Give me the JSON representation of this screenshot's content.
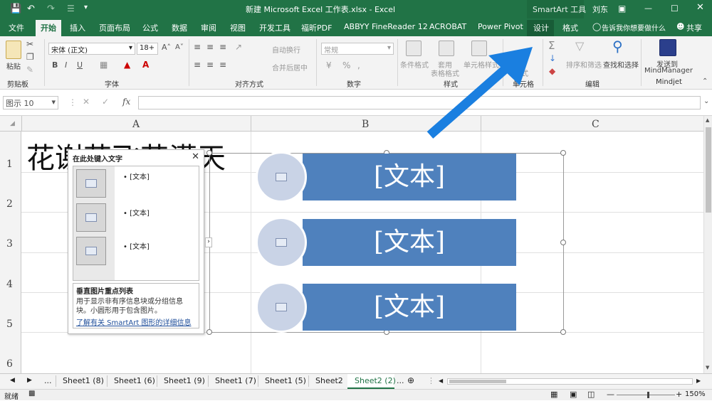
{
  "titlebar": {
    "document_title": "新建 Microsoft Excel 工作表.xlsx - Excel",
    "context_tools": "SmartArt 工具",
    "user": "刘东"
  },
  "tabs": [
    "文件",
    "开始",
    "插入",
    "页面布局",
    "公式",
    "数据",
    "审阅",
    "视图",
    "开发工具",
    "福昕PDF",
    "ABBYY FineReader 12",
    "ACROBAT",
    "Power Pivot",
    "设计",
    "格式"
  ],
  "tell_me": "告诉我你想要做什么",
  "share": "共享",
  "ribbon": {
    "clipboard": {
      "paste": "粘贴",
      "label": "剪贴板"
    },
    "font": {
      "name": "宋体 (正文)",
      "size": "18+",
      "label": "字体"
    },
    "alignment": {
      "wrap": "自动换行",
      "merge": "合并后居中",
      "label": "对齐方式"
    },
    "number": {
      "format": "常规",
      "label": "数字"
    },
    "styles": {
      "conditional": "条件格式",
      "table": "套用\n表格格式",
      "cell": "单元格样式",
      "label": "样式"
    },
    "cells": {
      "format": "格式",
      "label": "单元格"
    },
    "editing": {
      "sort": "排序和筛选",
      "find": "查找和选择",
      "label": "编辑"
    },
    "mindjet": {
      "send": "发送到\nMindManager",
      "label": "Mindjet"
    }
  },
  "formula_bar": {
    "name_box": "图示 10",
    "fx": "fx",
    "content": ""
  },
  "grid": {
    "columns": [
      "A",
      "B",
      "C"
    ],
    "rows": [
      "1",
      "2",
      "3",
      "4",
      "5",
      "6"
    ],
    "a1_value": "花谢花飞花满天"
  },
  "smartart": {
    "items": [
      "[文本]",
      "[文本]",
      "[文本]"
    ]
  },
  "text_pane": {
    "title": "在此处键入文字",
    "bullets": [
      "[文本]",
      "[文本]",
      "[文本]"
    ],
    "layout_name": "垂直图片重点列表",
    "description": "用于显示非有序信息块或分组信息块。小圆形用于包含图片。",
    "more_link": "了解有关 SmartArt 图形的详细信息"
  },
  "sheets": [
    "Sheet1 (8)",
    "Sheet1 (6)",
    "Sheet1 (9)",
    "Sheet1 (7)",
    "Sheet1 (5)",
    "Sheet2",
    "Sheet2 (2)"
  ],
  "status": {
    "ready": "就绪",
    "zoom": "150%"
  },
  "colors": {
    "excel_green": "#217346",
    "smartart_blue": "#4f81bd",
    "arrow_blue": "#1a7fe0"
  }
}
